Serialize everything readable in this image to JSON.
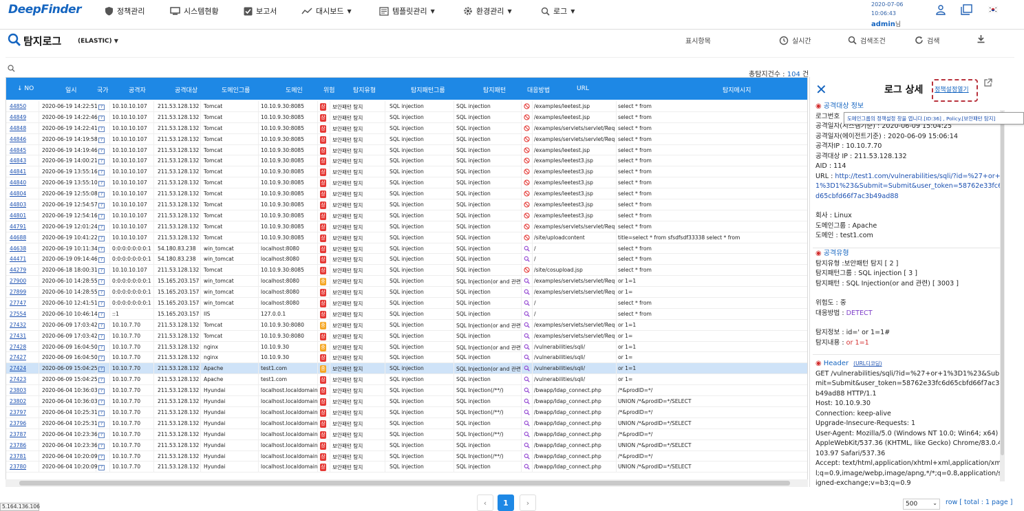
{
  "header": {
    "logo": "DeepFinder",
    "nav": [
      {
        "label": "정책관리",
        "icon": "shield-icon",
        "caret": false
      },
      {
        "label": "시스템현황",
        "icon": "monitor-icon",
        "caret": false
      },
      {
        "label": "보고서",
        "icon": "checkbox-icon",
        "caret": false
      },
      {
        "label": "대시보드",
        "icon": "chart-icon",
        "caret": true
      },
      {
        "label": "템플릿관리",
        "icon": "template-icon",
        "caret": true
      },
      {
        "label": "환경관리",
        "icon": "gear-icon",
        "caret": true
      },
      {
        "label": "로그",
        "icon": "search-icon",
        "caret": true
      }
    ],
    "date": "2020-07-06",
    "time": "10:06:43",
    "user": "admin",
    "user_suffix": "님"
  },
  "page": {
    "title": "탐지로그",
    "subtitle": "(ELASTIC)",
    "tools": {
      "display": "표시항목",
      "realtime": "실시간",
      "condition": "검색조건",
      "search": "검색"
    },
    "total_label": "총탐지건수 : ",
    "total_count": "104",
    "total_unit": " 건"
  },
  "table": {
    "columns": [
      "NO",
      "일시",
      "국가",
      "공격자",
      "공격대상",
      "도메인그룹",
      "도메인",
      "위험",
      "탐지유형",
      "탐지패턴그룹",
      "탐지패턴",
      "대응방법",
      "URL",
      "탐지메시지"
    ],
    "rows": [
      [
        "44850",
        "2020-06-19 14:22:51",
        "10.10.10.107",
        "211.53.128.132",
        "Tomcat",
        "10.10.9.30:8085",
        "상",
        "보안패턴 탐지",
        "SQL injection",
        "SQL injection",
        "block",
        "/examples/leetest.jsp",
        "select * from"
      ],
      [
        "44849",
        "2020-06-19 14:22:46",
        "10.10.10.107",
        "211.53.128.132",
        "Tomcat",
        "10.10.9.30:8085",
        "상",
        "보안패턴 탐지",
        "SQL injection",
        "SQL injection",
        "block",
        "/examples/leetest.jsp",
        "select * from"
      ],
      [
        "44848",
        "2020-06-19 14:22:41",
        "10.10.10.107",
        "211.53.128.132",
        "Tomcat",
        "10.10.9.30:8085",
        "상",
        "보안패턴 탐지",
        "SQL injection",
        "SQL injection",
        "block",
        "/examples/servlets/servlet/Requ",
        "select * from"
      ],
      [
        "44846",
        "2020-06-19 14:19:58",
        "10.10.10.107",
        "211.53.128.132",
        "Tomcat",
        "10.10.9.30:8085",
        "상",
        "보안패턴 탐지",
        "SQL injection",
        "SQL injection",
        "block",
        "/examples/servlets/servlet/Requ",
        "select * from"
      ],
      [
        "44845",
        "2020-06-19 14:19:46",
        "10.10.10.107",
        "211.53.128.132",
        "Tomcat",
        "10.10.9.30:8085",
        "상",
        "보안패턴 탐지",
        "SQL injection",
        "SQL injection",
        "block",
        "/examples/leetest.jsp",
        "select * from"
      ],
      [
        "44843",
        "2020-06-19 14:00:21",
        "10.10.10.107",
        "211.53.128.132",
        "Tomcat",
        "10.10.9.30:8085",
        "상",
        "보안패턴 탐지",
        "SQL injection",
        "SQL injection",
        "block",
        "/examples/leetest3.jsp",
        "select * from"
      ],
      [
        "44841",
        "2020-06-19 13:55:16",
        "10.10.10.107",
        "211.53.128.132",
        "Tomcat",
        "10.10.9.30:8085",
        "상",
        "보안패턴 탐지",
        "SQL injection",
        "SQL injection",
        "block",
        "/examples/leetest3.jsp",
        "select * from"
      ],
      [
        "44840",
        "2020-06-19 13:55:10",
        "10.10.10.107",
        "211.53.128.132",
        "Tomcat",
        "10.10.9.30:8085",
        "상",
        "보안패턴 탐지",
        "SQL injection",
        "SQL injection",
        "block",
        "/examples/leetest3.jsp",
        "select * from"
      ],
      [
        "44804",
        "2020-06-19 12:55:08",
        "10.10.10.107",
        "211.53.128.132",
        "Tomcat",
        "10.10.9.30:8085",
        "상",
        "보안패턴 탐지",
        "SQL injection",
        "SQL injection",
        "block",
        "/examples/leetest3.jsp",
        "select * from"
      ],
      [
        "44803",
        "2020-06-19 12:54:57",
        "10.10.10.107",
        "211.53.128.132",
        "Tomcat",
        "10.10.9.30:8085",
        "상",
        "보안패턴 탐지",
        "SQL injection",
        "SQL injection",
        "block",
        "/examples/leetest3.jsp",
        "select * from"
      ],
      [
        "44801",
        "2020-06-19 12:54:16",
        "10.10.10.107",
        "211.53.128.132",
        "Tomcat",
        "10.10.9.30:8085",
        "상",
        "보안패턴 탐지",
        "SQL injection",
        "SQL injection",
        "block",
        "/examples/leetest3.jsp",
        "select * from"
      ],
      [
        "44791",
        "2020-06-19 12:01:24",
        "10.10.10.107",
        "211.53.128.132",
        "Tomcat",
        "10.10.9.30:8085",
        "상",
        "보안패턴 탐지",
        "SQL injection",
        "SQL injection",
        "block",
        "/examples/servlets/servlet/Requ",
        "select * from"
      ],
      [
        "44688",
        "2020-06-19 10:41:22",
        "10.10.10.107",
        "211.53.128.132",
        "Tomcat",
        "10.10.9.30:8085",
        "상",
        "보안패턴 탐지",
        "SQL injection",
        "SQL injection",
        "block",
        "/site/uploadcontent",
        "title=select * from sfsdfsdf33338 select * from"
      ],
      [
        "44638",
        "2020-06-19 10:11:34",
        "0:0:0:0:0:0:0:1",
        "54.180.83.238",
        "win_tomcat",
        "localhost:8080",
        "상",
        "보안패턴 탐지",
        "SQL injection",
        "SQL injection",
        "detect",
        "/",
        "select * from"
      ],
      [
        "44471",
        "2020-06-19 09:14:46",
        "0:0:0:0:0:0:0:1",
        "54.180.83.238",
        "win_tomcat",
        "localhost:8080",
        "상",
        "보안패턴 탐지",
        "SQL injection",
        "SQL injection",
        "detect",
        "/",
        "select * from"
      ],
      [
        "44279",
        "2020-06-18 18:00:31",
        "10.10.10.107",
        "211.53.128.132",
        "Tomcat",
        "10.10.9.30:8085",
        "상",
        "보안패턴 탐지",
        "SQL injection",
        "SQL injection",
        "block",
        "/site/cosupload.jsp",
        "select * from"
      ],
      [
        "27900",
        "2020-06-10 14:28:55",
        "0:0:0:0:0:0:0:1",
        "15.165.203.157",
        "win_tomcat",
        "localhost:8080",
        "중",
        "보안패턴 탐지",
        "SQL injection",
        "SQL Injection(or and 관련)",
        "detect",
        "/examples/servlets/servlet/Requ",
        "or 1=1"
      ],
      [
        "27899",
        "2020-06-10 14:28:55",
        "0:0:0:0:0:0:0:1",
        "15.165.203.157",
        "win_tomcat",
        "localhost:8080",
        "상",
        "보안패턴 탐지",
        "SQL injection",
        "SQL injection",
        "detect",
        "/examples/servlets/servlet/Requ",
        "or 1="
      ],
      [
        "27747",
        "2020-06-10 12:41:51",
        "0:0:0:0:0:0:0:1",
        "15.165.203.157",
        "win_tomcat",
        "localhost:8080",
        "상",
        "보안패턴 탐지",
        "SQL injection",
        "SQL injection",
        "detect",
        "/",
        "select * from"
      ],
      [
        "27554",
        "2020-06-10 10:46:14",
        "::1",
        "15.165.203.157",
        "IIS",
        "127.0.0.1",
        "상",
        "보안패턴 탐지",
        "SQL injection",
        "SQL injection",
        "detect",
        "/",
        "select * from"
      ],
      [
        "27432",
        "2020-06-09 17:03:42",
        "10.10.7.70",
        "211.53.128.132",
        "Tomcat",
        "10.10.9.30:8080",
        "중",
        "보안패턴 탐지",
        "SQL injection",
        "SQL Injection(or and 관련)",
        "detect",
        "/examples/servlets/servlet/Requ",
        "or 1=1"
      ],
      [
        "27431",
        "2020-06-09 17:03:42",
        "10.10.7.70",
        "211.53.128.132",
        "Tomcat",
        "10.10.9.30:8080",
        "상",
        "보안패턴 탐지",
        "SQL injection",
        "SQL injection",
        "detect",
        "/examples/servlets/servlet/Requ",
        "or 1="
      ],
      [
        "27428",
        "2020-06-09 16:04:50",
        "10.10.7.70",
        "211.53.128.132",
        "nginx",
        "10.10.9.30",
        "중",
        "보안패턴 탐지",
        "SQL injection",
        "SQL Injection(or and 관련)",
        "detect",
        "/vulnerabilities/sqli/",
        "or 1=1"
      ],
      [
        "27427",
        "2020-06-09 16:04:50",
        "10.10.7.70",
        "211.53.128.132",
        "nginx",
        "10.10.9.30",
        "상",
        "보안패턴 탐지",
        "SQL injection",
        "SQL injection",
        "detect",
        "/vulnerabilities/sqli/",
        "or 1="
      ],
      [
        "27424",
        "2020-06-09 15:04:25",
        "10.10.7.70",
        "211.53.128.132",
        "Apache",
        "test1.com",
        "중",
        "보안패턴 탐지",
        "SQL injection",
        "SQL Injection(or and 관련)",
        "detect",
        "/vulnerabilities/sqli/",
        "or 1=1"
      ],
      [
        "27423",
        "2020-06-09 15:04:25",
        "10.10.7.70",
        "211.53.128.132",
        "Apache",
        "test1.com",
        "상",
        "보안패턴 탐지",
        "SQL injection",
        "SQL injection",
        "detect",
        "/vulnerabilities/sqli/",
        "or 1="
      ],
      [
        "23803",
        "2020-06-04 10:36:03",
        "10.10.7.70",
        "211.53.128.132",
        "Hyundai",
        "localhost.localdomain",
        "상",
        "보안패턴 탐지",
        "SQL injection",
        "SQL Injection(/**/)",
        "detect",
        "/bwapp/ldap_connect.php",
        "/*&prodID=*/"
      ],
      [
        "23802",
        "2020-06-04 10:36:03",
        "10.10.7.70",
        "211.53.128.132",
        "Hyundai",
        "localhost.localdomain",
        "상",
        "보안패턴 탐지",
        "SQL injection",
        "SQL injection",
        "detect",
        "/bwapp/ldap_connect.php",
        "UNION /*&prodID=*/SELECT"
      ],
      [
        "23797",
        "2020-06-04 10:25:31",
        "10.10.7.70",
        "211.53.128.132",
        "Hyundai",
        "localhost.localdomain",
        "상",
        "보안패턴 탐지",
        "SQL injection",
        "SQL Injection(/**/)",
        "detect",
        "/bwapp/ldap_connect.php",
        "/*&prodID=*/"
      ],
      [
        "23796",
        "2020-06-04 10:25:31",
        "10.10.7.70",
        "211.53.128.132",
        "Hyundai",
        "localhost.localdomain",
        "상",
        "보안패턴 탐지",
        "SQL injection",
        "SQL injection",
        "detect",
        "/bwapp/ldap_connect.php",
        "UNION /*&prodID=*/SELECT"
      ],
      [
        "23787",
        "2020-06-04 10:23:36",
        "10.10.7.70",
        "211.53.128.132",
        "Hyundai",
        "localhost.localdomain",
        "상",
        "보안패턴 탐지",
        "SQL injection",
        "SQL Injection(/**/)",
        "detect",
        "/bwapp/ldap_connect.php",
        "/*&prodID=*/"
      ],
      [
        "23786",
        "2020-06-04 10:23:36",
        "10.10.7.70",
        "211.53.128.132",
        "Hyundai",
        "localhost.localdomain",
        "상",
        "보안패턴 탐지",
        "SQL injection",
        "SQL injection",
        "detect",
        "/bwapp/ldap_connect.php",
        "UNION /*&prodID=*/SELECT"
      ],
      [
        "23781",
        "2020-06-04 10:20:09",
        "10.10.7.70",
        "211.53.128.132",
        "Hyundai",
        "localhost.localdomain",
        "상",
        "보안패턴 탐지",
        "SQL injection",
        "SQL Injection(/**/)",
        "detect",
        "/bwapp/ldap_connect.php",
        "/*&prodID=*/"
      ],
      [
        "23780",
        "2020-06-04 10:20:09",
        "10.10.7.70",
        "211.53.128.132",
        "Hyundai",
        "localhost.localdomain",
        "상",
        "보안패턴 탐지",
        "SQL injection",
        "SQL injection",
        "detect",
        "/bwapp/ldap_connect.php",
        "UNION /*&prodID=*/SELECT"
      ]
    ],
    "selected_row_no": "27424"
  },
  "detail": {
    "title": "로그 상세",
    "link": "정책설정열기",
    "tooltip": "도메인그룹의 정책설정 창을 엽니다.[ID:36] , Policy.[보안패턴 탐지]",
    "attack_header": "공격대상 정보",
    "attack": [
      {
        "k": "로그번호",
        "v": ""
      },
      {
        "k": "공격일자(시스템기준)",
        "v": " : 2020-06-09 15:04:25"
      },
      {
        "k": "공격일자(에이전트기준)",
        "v": " : 2020-06-09 15:06:14"
      },
      {
        "k": "공격자IP",
        "v": " : 10.10.7.70"
      },
      {
        "k": "공격대상 IP",
        "v": " : 211.53.128.132"
      },
      {
        "k": "AID",
        "v": " : 114"
      }
    ],
    "url_label": "URL : ",
    "url_value": "http://test1.com/vulnerabilities/sqli/?id=%27+or+1%3D1%23&Submit=Submit&user_token=58762e33fc6d65cbfd66f7ac3b49ad88",
    "company": [
      {
        "k": "회사",
        "v": " : Linux"
      },
      {
        "k": "도메인그룹",
        "v": " : Apache"
      },
      {
        "k": "도메인",
        "v": " : test1.com"
      }
    ],
    "type_header": "공격유형",
    "types": [
      {
        "k": "탐지유형",
        "v": " :보안패턴 탐지 [ 2 ]"
      },
      {
        "k": "탐지패턴그룹",
        "v": " : SQL injection [ 3 ]"
      },
      {
        "k": "탐지패턴",
        "v": " : SQL Injection(or and 관련) [ 3003 ]"
      }
    ],
    "risk_label": "위험도 : ",
    "risk_value": "중",
    "response_label": "대응방법 : ",
    "response_value": "DETECT",
    "info_label": "탐지정보 : ",
    "info_value": "id=' or 1=1#",
    "content_label": "탐지내용 : ",
    "content_value": "or 1=1",
    "header_title": "Header",
    "header_link": "(URL디코딩)",
    "header_lines": [
      "GET /vulnerabilities/sqli/?id=%27+or+1%3D1%23&Submit=Submit&user_token=58762e33fc6d65cbfd66f7ac3b49ad88 HTTP/1.1",
      "Host: 10.10.9.30",
      "Connection: keep-alive",
      "Upgrade-Insecure-Requests: 1",
      "User-Agent: Mozilla/5.0 (Windows NT 10.0; Win64; x64) AppleWebKit/537.36 (KHTML, like Gecko) Chrome/83.0.4103.97 Safari/537.36",
      "Accept: text/html,application/xhtml+xml,application/xml;q=0.9,image/webp,image/apng,*/*;q=0.8,application/signed-exchange;v=b3;q=0.9"
    ]
  },
  "footer": {
    "page": "1",
    "rows_per_page": "500",
    "row_info": "row [ total : 1 page ]",
    "ip": "5.164.136.106"
  },
  "colors": {
    "accent": "#1e88e5",
    "risk_high": "#e53935",
    "risk_mid": "#f5a623",
    "block": "#e53935",
    "detect": "#8e3fd0"
  }
}
